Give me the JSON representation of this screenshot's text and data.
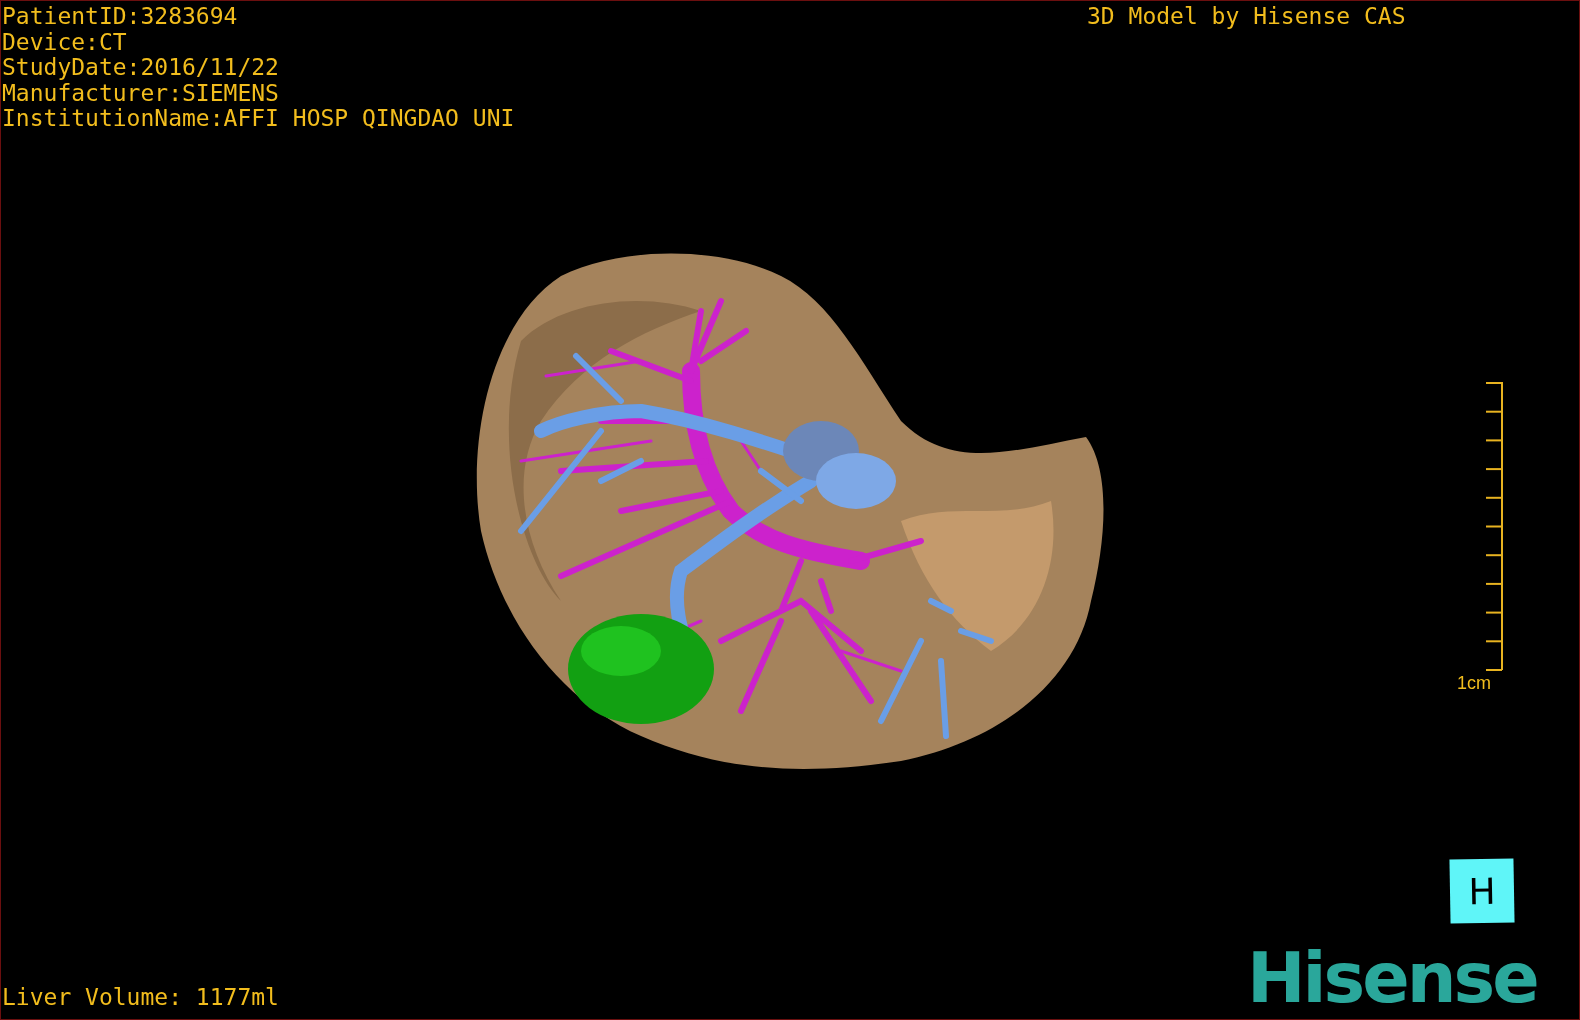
{
  "viewport": {
    "info_lines": [
      "PatientID:3283694",
      "Device:CT",
      "StudyDate:2016/11/22",
      "Manufacturer:SIEMENS",
      "InstitutionName:AFFI HOSP QINGDAO UNI"
    ],
    "model_title": "3D Model by Hisense CAS",
    "scale_bar": {
      "label": "1cm"
    },
    "orientation_marker": "H",
    "liver_volume": "Liver Volume: 1177ml",
    "logo": "Hisense"
  }
}
